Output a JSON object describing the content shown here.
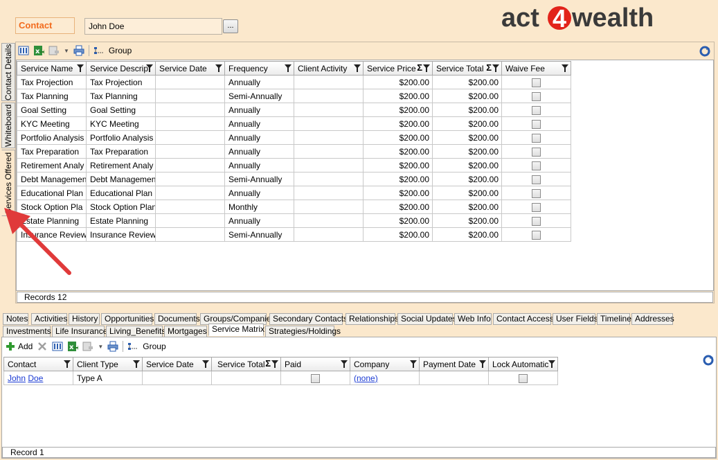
{
  "header": {
    "contact_label": "Contact",
    "contact_value": "John Doe",
    "ellipsis_label": "...",
    "logo_part1": "act",
    "logo_part2": "4",
    "logo_part3": "wealth"
  },
  "side_tabs": [
    "Contact Details",
    "Whiteboard",
    "Services Offered"
  ],
  "top_toolbar": {
    "group_label": "Group"
  },
  "services_grid": {
    "columns": [
      "Service Name",
      "Service Descrip",
      "Service Date",
      "Frequency",
      "Client Activity",
      "Service Price",
      "Service Total",
      "Waive Fee"
    ],
    "rows": [
      [
        "Tax Projection",
        "Tax Projection",
        "",
        "Annually",
        "",
        "$200.00",
        "$200.00"
      ],
      [
        "Tax Planning",
        "Tax Planning",
        "",
        "Semi-Annually",
        "",
        "$200.00",
        "$200.00"
      ],
      [
        "Goal Setting",
        "Goal Setting",
        "",
        "Annually",
        "",
        "$200.00",
        "$200.00"
      ],
      [
        "KYC Meeting",
        "KYC Meeting",
        "",
        "Annually",
        "",
        "$200.00",
        "$200.00"
      ],
      [
        "Portfolio Analysis",
        "Portfolio Analysis",
        "",
        "Annually",
        "",
        "$200.00",
        "$200.00"
      ],
      [
        "Tax Preparation",
        "Tax Preparation",
        "",
        "Annually",
        "",
        "$200.00",
        "$200.00"
      ],
      [
        "Retirement Analy",
        "Retirement Analy",
        "",
        "Annually",
        "",
        "$200.00",
        "$200.00"
      ],
      [
        "Debt Managemen",
        "Debt Managemen",
        "",
        "Semi-Annually",
        "",
        "$200.00",
        "$200.00"
      ],
      [
        "Educational Plan",
        "Educational Plan",
        "",
        "Annually",
        "",
        "$200.00",
        "$200.00"
      ],
      [
        "Stock Option Pla",
        "Stock Option Plan",
        "",
        "Monthly",
        "",
        "$200.00",
        "$200.00"
      ],
      [
        "Estate Planning",
        "Estate Planning",
        "",
        "Annually",
        "",
        "$200.00",
        "$200.00"
      ],
      [
        "Insurance Review",
        "Insurance Review",
        "",
        "Semi-Annually",
        "",
        "$200.00",
        "$200.00"
      ]
    ],
    "records_label": "Records 12"
  },
  "bottom_tabs_row1": [
    "Notes",
    "Activities",
    "History",
    "Opportunities",
    "Documents",
    "Groups/Companies",
    "Secondary Contacts",
    "Relationships",
    "Social Updates",
    "Web Info",
    "Contact Access",
    "User Fields",
    "Timeline",
    "Addresses"
  ],
  "bottom_tabs_row2": [
    "Investments",
    "Life Insurance",
    "Living_Benefits",
    "Mortgages",
    "Service Matrix",
    "Strategies/Holdings"
  ],
  "active_bottom_tab": "Service Matrix",
  "bottom_toolbar": {
    "add_label": "Add",
    "group_label": "Group"
  },
  "matrix_grid": {
    "columns": [
      "Contact",
      "Client Type",
      "Service Date",
      "Service Total",
      "Paid",
      "Company",
      "Payment Date",
      "Lock Automatic"
    ],
    "row": {
      "contact_first": "John",
      "contact_last": "Doe",
      "client_type": "Type A",
      "company": "(none)"
    },
    "record_label": "Record 1"
  },
  "colors": {
    "background": "#fbe8cc",
    "accent_orange": "#f26b1d",
    "logo_dark": "#3a3a3a",
    "logo_red": "#e2231a",
    "link_blue": "#1a3ad3"
  }
}
